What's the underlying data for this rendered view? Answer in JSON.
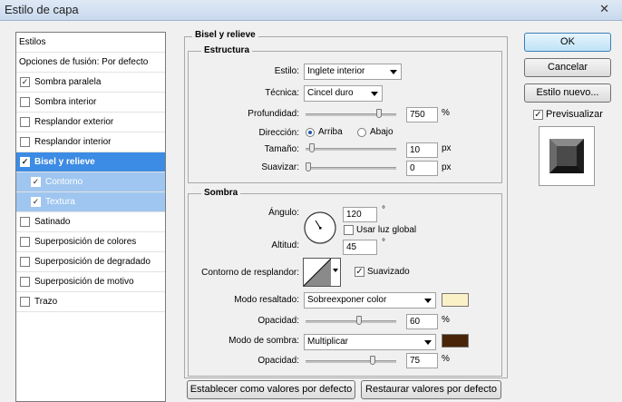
{
  "window": {
    "title": "Estilo de capa"
  },
  "sidebar": {
    "items": [
      {
        "label": "Estilos",
        "check": null,
        "state": "plain"
      },
      {
        "label": "Opciones de fusión: Por defecto",
        "check": null,
        "state": "plain"
      },
      {
        "label": "Sombra paralela",
        "check": "✓",
        "state": ""
      },
      {
        "label": "Sombra interior",
        "check": "",
        "state": ""
      },
      {
        "label": "Resplandor exterior",
        "check": "",
        "state": ""
      },
      {
        "label": "Resplandor interior",
        "check": "",
        "state": ""
      },
      {
        "label": "Bisel y relieve",
        "check": "✓",
        "state": "sel"
      },
      {
        "label": "Contorno",
        "check": "✓",
        "state": "sub"
      },
      {
        "label": "Textura",
        "check": "✓",
        "state": "sub"
      },
      {
        "label": "Satinado",
        "check": "",
        "state": ""
      },
      {
        "label": "Superposición de colores",
        "check": "",
        "state": ""
      },
      {
        "label": "Superposición de degradado",
        "check": "",
        "state": ""
      },
      {
        "label": "Superposición de motivo",
        "check": "",
        "state": ""
      },
      {
        "label": "Trazo",
        "check": "",
        "state": ""
      }
    ]
  },
  "bevel": {
    "section_title": "Bisel y relieve",
    "structure_title": "Estructura",
    "style_label": "Estilo:",
    "style_value": "Inglete interior",
    "technique_label": "Técnica:",
    "technique_value": "Cincel duro",
    "depth_label": "Profundidad:",
    "depth_value": "750",
    "depth_unit": "%",
    "depth_level": 0.83,
    "direction_label": "Dirección:",
    "direction_up": "Arriba",
    "direction_down": "Abajo",
    "size_label": "Tamaño:",
    "size_value": "10",
    "size_unit": "px",
    "size_level": 0.04,
    "soften_label": "Suavizar:",
    "soften_value": "0",
    "soften_unit": "px",
    "soften_level": 0.0
  },
  "shading": {
    "title": "Sombra",
    "angle_label": "Ángulo:",
    "angle_value": "120",
    "angle_unit": "°",
    "global_light_label": "Usar luz global",
    "altitude_label": "Altitud:",
    "altitude_value": "45",
    "altitude_unit": "°",
    "gloss_contour_label": "Contorno de resplandor:",
    "anti_aliased_label": "Suavizado",
    "highlight_mode_label": "Modo resaltado:",
    "highlight_mode_value": "Sobreexponer color",
    "highlight_color": "#fbf1c6",
    "highlight_opacity_label": "Opacidad:",
    "highlight_opacity_value": "60",
    "highlight_opacity_unit": "%",
    "highlight_opacity_level": 0.6,
    "shadow_mode_label": "Modo de sombra:",
    "shadow_mode_value": "Multiplicar",
    "shadow_color": "#4a2408",
    "shadow_opacity_label": "Opacidad:",
    "shadow_opacity_value": "75",
    "shadow_opacity_unit": "%",
    "shadow_opacity_level": 0.75
  },
  "footer": {
    "make_default": "Establecer como valores por defecto",
    "reset_default": "Restaurar valores por defecto"
  },
  "actions": {
    "ok": "OK",
    "cancel": "Cancelar",
    "new_style": "Estilo nuevo...",
    "preview_label": "Previsualizar"
  }
}
